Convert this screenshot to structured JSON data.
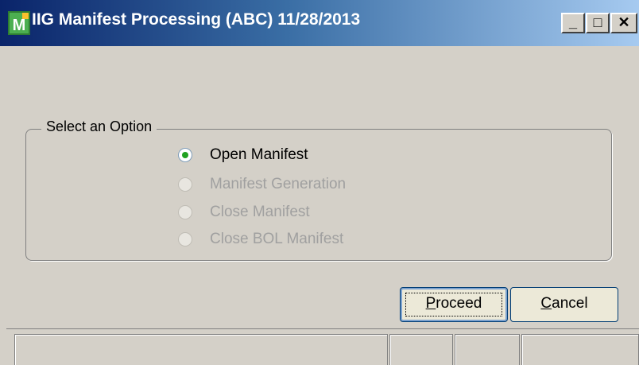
{
  "window": {
    "title": "IIG Manifest Processing (ABC) 11/28/2013",
    "controls": {
      "minimize": "_",
      "maximize": "□",
      "close": "✕"
    }
  },
  "options_group": {
    "label": "Select an Option",
    "options": [
      {
        "label": "Open Manifest",
        "selected": true,
        "enabled": true
      },
      {
        "label": "Manifest Generation",
        "selected": false,
        "enabled": false
      },
      {
        "label": "Close Manifest",
        "selected": false,
        "enabled": false
      },
      {
        "label": "Close BOL Manifest",
        "selected": false,
        "enabled": false
      }
    ]
  },
  "buttons": {
    "proceed": {
      "mnemonic": "P",
      "rest": "roceed"
    },
    "cancel": {
      "mnemonic": "C",
      "rest": "ancel"
    }
  },
  "status_bar": {
    "cells": [
      "",
      "",
      "",
      ""
    ]
  },
  "colors": {
    "title_start": "#0a246a",
    "title_end": "#a6caf0",
    "window_bg": "#d4d0c8",
    "radio_selected": "#21a121"
  }
}
